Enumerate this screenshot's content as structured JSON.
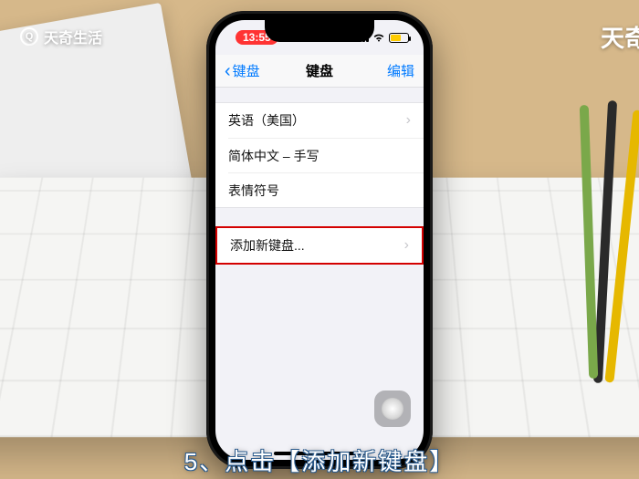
{
  "watermark": {
    "left": "天奇生活",
    "right": "天奇"
  },
  "caption": "5、点击【添加新键盘】",
  "status": {
    "time": "13:55"
  },
  "nav": {
    "back": "键盘",
    "title": "键盘",
    "edit": "编辑"
  },
  "keyboards": {
    "items": [
      {
        "label": "英语（美国）",
        "disclosure": true
      },
      {
        "label": "简体中文 – 手写",
        "disclosure": false
      },
      {
        "label": "表情符号",
        "disclosure": false
      }
    ]
  },
  "add": {
    "label": "添加新键盘...",
    "disclosure": true
  }
}
